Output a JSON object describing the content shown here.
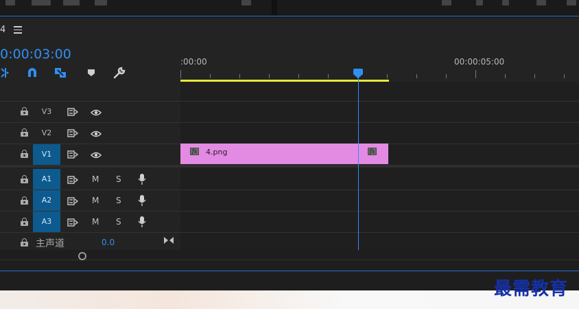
{
  "sequence": {
    "title": "4",
    "timecode": "0:00:03:00"
  },
  "ruler": {
    "start_label": ":00:00",
    "mark_label": "00:00:05:00"
  },
  "icons": {
    "menu": "hamburger-menu-icon",
    "snap": "snap-magnet-icon",
    "linked": "linked-selection-icon",
    "marker": "add-marker-icon",
    "settings": "wrench-icon",
    "ripple": "insert-ripple-icon"
  },
  "video_tracks": [
    {
      "label": "V3",
      "active": false
    },
    {
      "label": "V2",
      "active": false
    },
    {
      "label": "V1",
      "active": true
    }
  ],
  "audio_tracks": [
    {
      "label": "A1",
      "mute": "M",
      "solo": "S",
      "active": true
    },
    {
      "label": "A2",
      "mute": "M",
      "solo": "S",
      "active": true
    },
    {
      "label": "A3",
      "mute": "M",
      "solo": "S",
      "active": true
    }
  ],
  "clip": {
    "name": "4.png",
    "fx_label": "fx",
    "color": "#e38ae3"
  },
  "master": {
    "label": "主声道",
    "value": "0.0"
  },
  "watermark": "最需教育",
  "colors": {
    "accent": "#2f8ff2",
    "work_area": "#e8e83a",
    "track_target": "#0d5a8e"
  }
}
